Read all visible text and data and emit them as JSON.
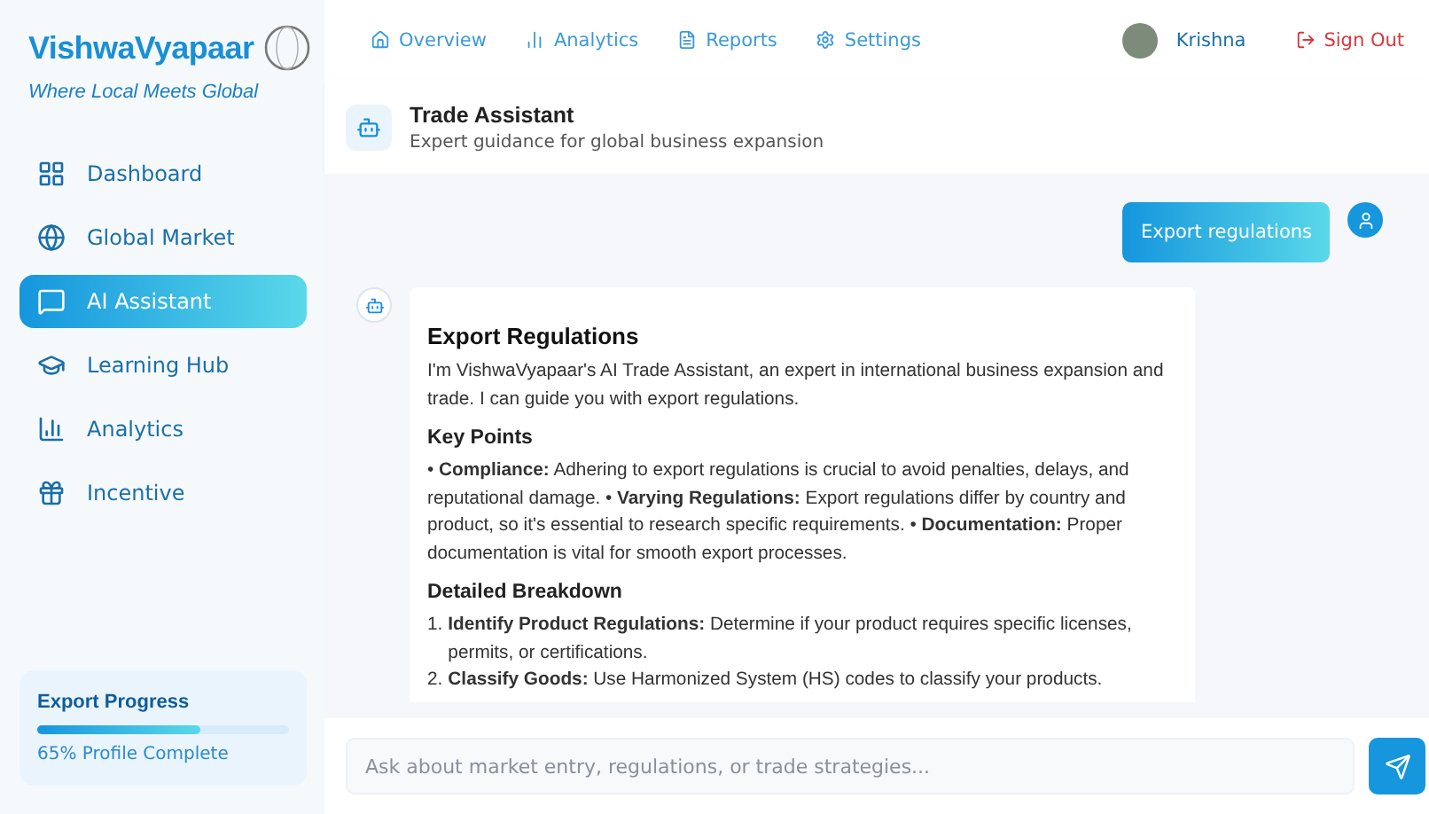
{
  "brand": {
    "name": "VishwaVyapaar",
    "tagline": "Where Local Meets Global"
  },
  "sidebar": {
    "items": [
      {
        "label": "Dashboard",
        "selected": false
      },
      {
        "label": "Global Market",
        "selected": false
      },
      {
        "label": "AI Assistant",
        "selected": true
      },
      {
        "label": "Learning Hub",
        "selected": false
      },
      {
        "label": "Analytics",
        "selected": false
      },
      {
        "label": "Incentive",
        "selected": false
      }
    ],
    "progress": {
      "title": "Export Progress",
      "level": 0.65,
      "caption": "65% Profile Complete"
    }
  },
  "top_nav": {
    "links": [
      {
        "label": "Overview"
      },
      {
        "label": "Analytics"
      },
      {
        "label": "Reports"
      },
      {
        "label": "Settings"
      }
    ],
    "user": {
      "name": "Krishna"
    },
    "sign_out": "Sign Out"
  },
  "chat_header": {
    "title": "Trade Assistant",
    "subtitle": "Expert guidance for global business expansion"
  },
  "messages": [
    {
      "kind": "user",
      "text": "Export regulations"
    },
    {
      "kind": "bot",
      "blocks": [
        {
          "kind": "h1",
          "text": "Export Regulations"
        },
        {
          "kind": "p",
          "text": "I'm VishwaVyapaar's AI Trade Assistant, an expert in international business expansion and trade. I can guide you with export regulations."
        },
        {
          "kind": "h2",
          "text": "Key Points"
        },
        {
          "kind": "p",
          "text": "• **Compliance:** Adhering to export regulations is crucial to avoid penalties, delays, and reputational damage. • **Varying Regulations:** Export regulations differ by country and product, so it's essential to research specific requirements. • **Documentation:** Proper documentation is vital for smooth export processes."
        },
        {
          "kind": "h2",
          "text": "Detailed Breakdown"
        },
        {
          "kind": "li",
          "num": "1.",
          "text": "**Identify Product Regulations:** Determine if your product requires specific licenses, permits, or certifications."
        },
        {
          "kind": "li",
          "num": "2.",
          "text": "**Classify Goods:** Use Harmonized System (HS) codes to classify your products."
        }
      ]
    }
  ],
  "composer": {
    "placeholder": "Ask about market entry, regulations, or trade strategies..."
  }
}
